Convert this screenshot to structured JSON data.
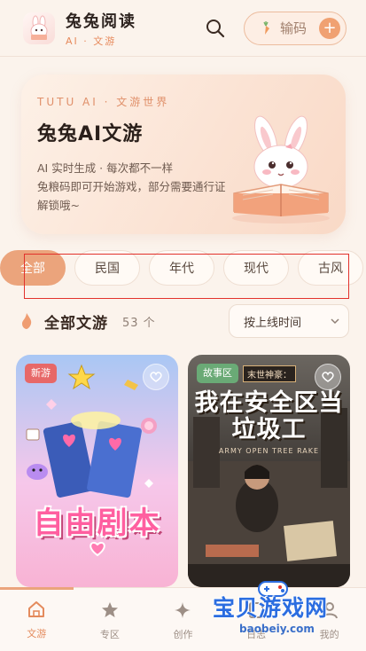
{
  "header": {
    "app_title": "兔兔阅读",
    "app_subtitle": "AI · 文游",
    "code_button_label": "输码",
    "plus_symbol": "+"
  },
  "hero": {
    "tag": "TUTU AI · 文游世界",
    "title": "兔兔AI文游",
    "desc_line1": "AI 实时生成 · 每次都不一样",
    "desc_line2": "兔粮码即可开始游戏，部分需要通行证解锁哦~"
  },
  "filters": [
    "全部",
    "民国",
    "年代",
    "现代",
    "古风"
  ],
  "section": {
    "title": "全部文游",
    "count": "53 个",
    "sort_value": "按上线时间"
  },
  "cards": [
    {
      "badge": "新游",
      "cover_text": "自由剧本"
    },
    {
      "badge": "故事区",
      "cover_top": "末世神豪：",
      "cover_text": "我在安全区当垃圾工",
      "cover_sub": "ARMY OPEN TREE RAKE"
    }
  ],
  "bottom_nav": [
    {
      "label": "文游",
      "icon": "home-icon"
    },
    {
      "label": "专区",
      "icon": "star-icon"
    },
    {
      "label": "创作",
      "icon": "sparkle-icon"
    },
    {
      "label": "日志",
      "icon": "book-icon"
    },
    {
      "label": "我的",
      "icon": "user-icon"
    }
  ],
  "watermark": {
    "title": "宝贝游戏网",
    "url": "baobeiy.com"
  },
  "colors": {
    "accent": "#eba47c",
    "background": "#fbf3ec",
    "annotation_box": "#e2322c"
  }
}
